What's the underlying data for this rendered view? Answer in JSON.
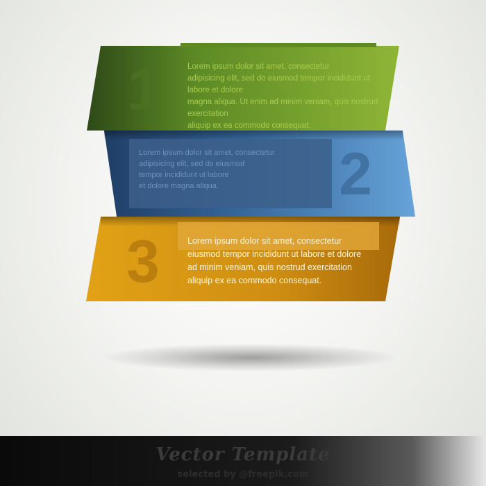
{
  "colors": {
    "band1": "#7da32c",
    "band2": "#4b85bd",
    "band3": "#d79714"
  },
  "bands": [
    {
      "number": "1",
      "text": "Lorem ipsum dolor sit amet, consectetur\nadipisicing elit, sed do eiusmod tempor incididunt ut labore et dolore\nmagna aliqua. Ut enim ad minim veniam, quis nostrud exercitation\naliquip ex ea commodo consequat."
    },
    {
      "number": "2",
      "text": "Lorem ipsum dolor sit amet, consectetur\nadipisicing elit, sed do eiusmod\ntempor incididunt ut labore\net dolore magna aliqua."
    },
    {
      "number": "3",
      "text": "Lorem ipsum dolor sit amet, consectetur\neiusmod tempor incididunt ut labore et dolore\nad minim veniam, quis nostrud exercitation\naliquip ex ea commodo consequat."
    }
  ],
  "footer": {
    "title": "Vector Template",
    "credit": "selected by @freepik.com"
  }
}
